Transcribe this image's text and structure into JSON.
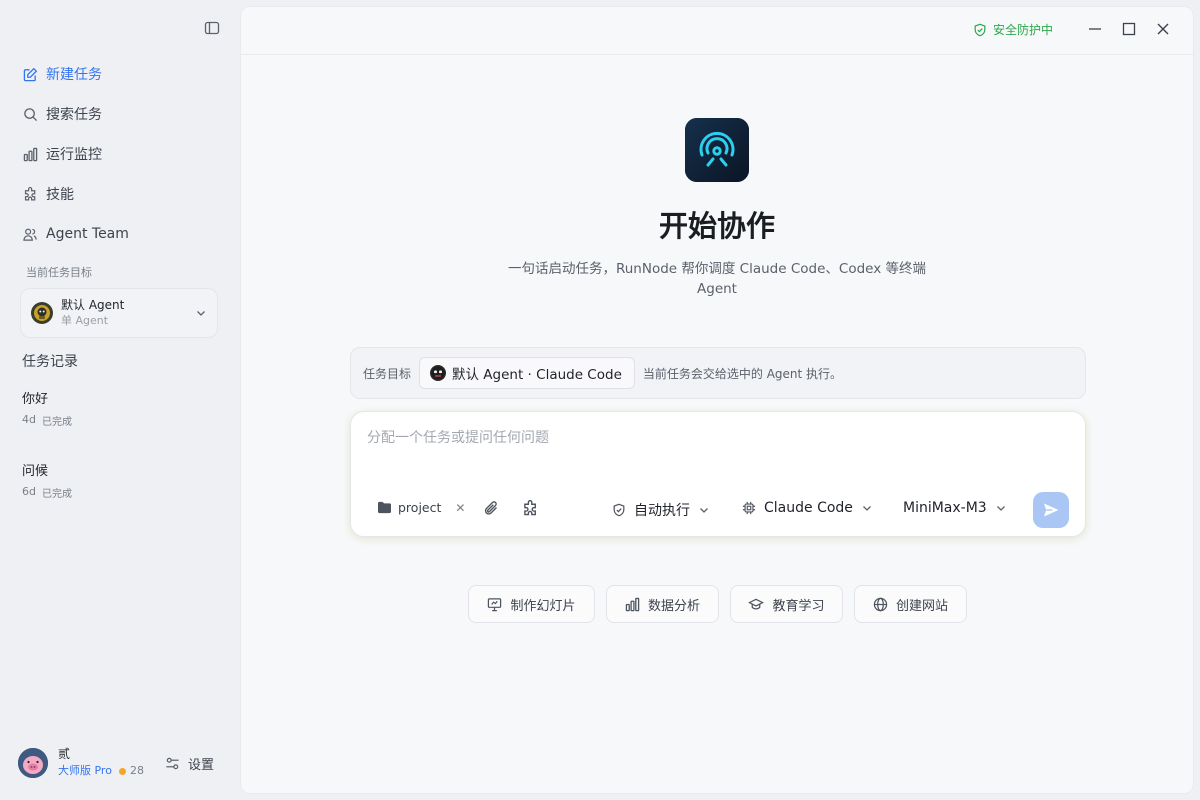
{
  "sidebar": {
    "nav": [
      {
        "label": "新建任务",
        "icon": "edit-icon"
      },
      {
        "label": "搜索任务",
        "icon": "search-icon"
      },
      {
        "label": "运行监控",
        "icon": "bar-chart-icon"
      },
      {
        "label": "技能",
        "icon": "puzzle-icon"
      },
      {
        "label": "Agent Team",
        "icon": "team-icon"
      }
    ],
    "current_target_label": "当前任务目标",
    "agent": {
      "name": "默认 Agent",
      "sub": "单 Agent"
    },
    "history_title": "任务记录",
    "history": [
      {
        "name": "你好",
        "age": "4d",
        "status": "已完成"
      },
      {
        "name": "问候",
        "age": "6d",
        "status": "已完成"
      }
    ],
    "user": {
      "name": "贰",
      "plan": "大师版 Pro",
      "points": "28"
    },
    "settings_label": "设置"
  },
  "topbar": {
    "security": "安全防护中"
  },
  "main": {
    "title": "开始协作",
    "description": "一句话启动任务，RunNode 帮你调度 Claude Code、Codex 等终端 Agent",
    "target": {
      "label": "任务目标",
      "chip": "默认 Agent · Claude Code",
      "note": "当前任务会交给选中的 Agent 执行。"
    },
    "composer": {
      "placeholder": "分配一个任务或提问任何问题",
      "project": "project",
      "mode": "自动执行",
      "engine": "Claude Code",
      "model": "MiniMax-M3"
    },
    "quick_actions": [
      {
        "label": "制作幻灯片",
        "icon": "presentation-icon"
      },
      {
        "label": "数据分析",
        "icon": "bar-chart-icon"
      },
      {
        "label": "教育学习",
        "icon": "graduation-cap-icon"
      },
      {
        "label": "创建网站",
        "icon": "globe-icon"
      }
    ]
  },
  "colors": {
    "accent": "#3574f0",
    "security_green": "#2ba84a",
    "send_button": "#a9c6f5",
    "points_dot": "#f5a623"
  }
}
